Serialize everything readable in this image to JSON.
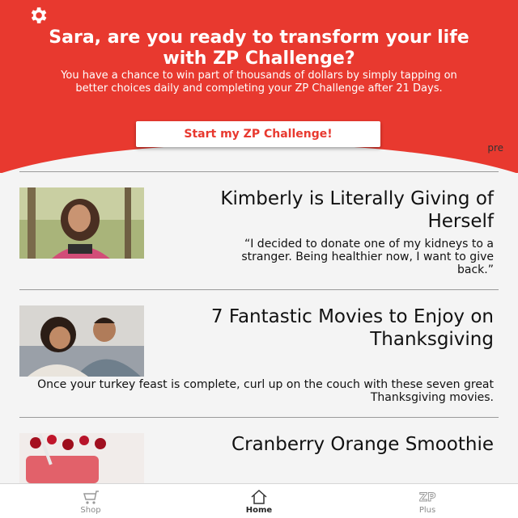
{
  "header": {
    "title": "Sara, are you ready to transform your life with ZP Challenge?",
    "subtitle": "You have a chance to win part of thousands of dollars by simply tapping on better choices daily and completing your ZP Challenge after 21 Days.",
    "cta_label": "Start my ZP Challenge!",
    "settings_icon": "gear-icon",
    "peek_text": "pre"
  },
  "articles": [
    {
      "title": "Kimberly is Literally Giving of Herself",
      "body": "“I decided to donate one of my kidneys to a stranger. Being healthier now, I want to give back.”"
    },
    {
      "title": "7 Fantastic Movies to Enjoy on Thanksgiving",
      "body": "Once your turkey feast is complete, curl up on the couch with these seven great Thanksgiving movies."
    },
    {
      "title": "Cranberry Orange Smoothie",
      "body": ""
    }
  ],
  "tabbar": {
    "items": [
      {
        "label": "Plus",
        "icon": "zp-plus-icon"
      },
      {
        "label": "Home",
        "icon": "home-icon",
        "active": true
      },
      {
        "label": "Shop",
        "icon": "cart-icon"
      }
    ]
  },
  "colors": {
    "brand_red": "#e8392f"
  }
}
